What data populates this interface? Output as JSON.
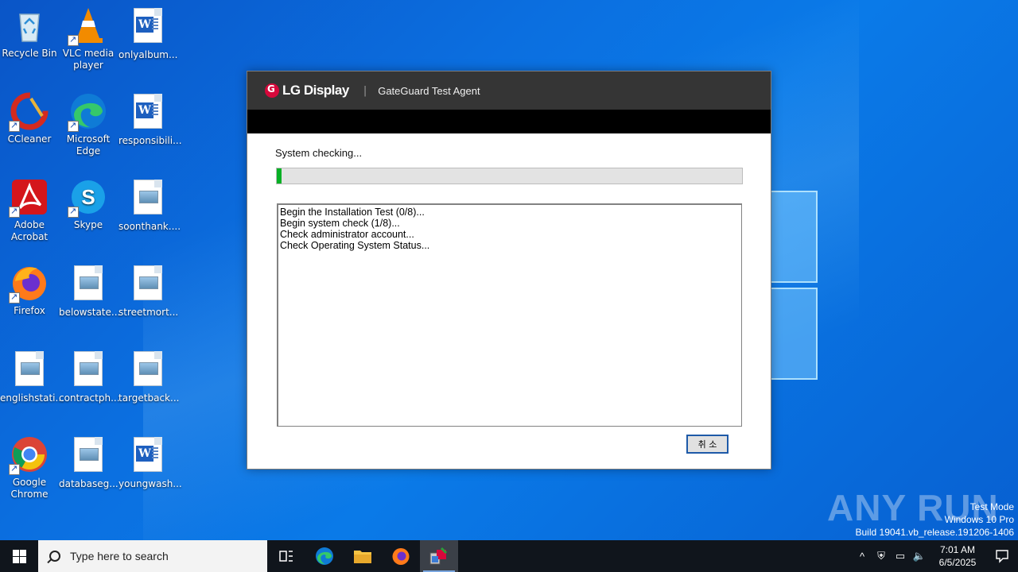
{
  "desktop": {
    "icons": [
      {
        "label": "Recycle Bin"
      },
      {
        "label": "VLC media player"
      },
      {
        "label": "onlyalbum..."
      },
      {
        "label": "CCleaner"
      },
      {
        "label": "Microsoft Edge"
      },
      {
        "label": "responsibili..."
      },
      {
        "label": "Adobe Acrobat"
      },
      {
        "label": "Skype"
      },
      {
        "label": "soonthank...."
      },
      {
        "label": "Firefox"
      },
      {
        "label": "belowstate..."
      },
      {
        "label": "streetmort..."
      },
      {
        "label": "englishstati..."
      },
      {
        "label": "contractph..."
      },
      {
        "label": "targetback..."
      },
      {
        "label": "Google Chrome"
      },
      {
        "label": "databaseg..."
      },
      {
        "label": "youngwash..."
      }
    ]
  },
  "dialog": {
    "brand": "LG Display",
    "separator": "|",
    "title": "GateGuard Test Agent",
    "status": "System checking...",
    "progress_fraction": 0.01,
    "log_lines": [
      "Begin the Installation Test (0/8)...",
      "Begin system check (1/8)...",
      "Check administrator account...",
      "Check Operating System Status..."
    ],
    "cancel_label": "취 소"
  },
  "watermark": {
    "brand": "ANY RUN",
    "line1": "Test Mode",
    "line2": "Windows 10 Pro",
    "line3": "Build 19041.vb_release.191206-1406"
  },
  "taskbar": {
    "search_placeholder": "Type here to search",
    "time": "7:01 AM",
    "date": "6/5/2025"
  }
}
